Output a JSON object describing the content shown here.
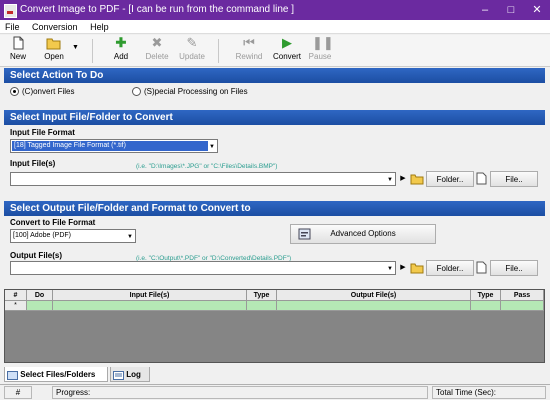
{
  "window": {
    "title": "Convert Image to PDF - [I can be run from the command line ]",
    "minimize": "–",
    "maximize": "□",
    "close": "✕"
  },
  "menu": [
    "File",
    "Conversion",
    "Help"
  ],
  "toolbar": {
    "new": "New",
    "open": "Open",
    "add": "Add",
    "delete": "Delete",
    "update": "Update",
    "rewind": "Rewind",
    "convert": "Convert",
    "pause": "Pause"
  },
  "select_action": {
    "header": "Select Action To Do",
    "option_convert": "(C)onvert Files",
    "option_special": "(S)pecial Processing on Files",
    "selected": "convert"
  },
  "input": {
    "header": "Select Input File/Folder to Convert",
    "format_label": "Input File Format",
    "format_value": "[18] Tagged Image File Format (*.tif)",
    "files_label": "Input File(s)",
    "files_hint": "(i.e. \"D:\\Images\\*.JPG\" or \"C:\\Files\\Details.BMP\")",
    "files_value": "",
    "folder_button": "Folder..",
    "file_button": "File.."
  },
  "output": {
    "header": "Select Output File/Folder and Format to Convert to",
    "format_label": "Convert to File Format",
    "format_value": "[100] Adobe (PDF)",
    "advanced_button": "Advanced Options",
    "files_label": "Output File(s)",
    "files_hint": "(i.e. \"C:\\Output\\*.PDF\" or \"D:\\Converted\\Details.PDF\")",
    "files_value": "",
    "folder_button": "Folder..",
    "file_button": "File.."
  },
  "grid": {
    "columns": [
      "#",
      "Do",
      "Input File(s)",
      "Type",
      "Output File(s)",
      "Type",
      "Pass"
    ],
    "new_row_marker": "*"
  },
  "tabs": {
    "files": "Select Files/Folders",
    "log": "Log"
  },
  "status": {
    "number": "#",
    "progress": "Progress:",
    "total_time": "Total Time (Sec):"
  },
  "colors": {
    "title_bar": "#6b2aa0",
    "section_band": "#1c4ea3",
    "hint_text": "#2a9d8f",
    "grid_new_row": "#b5e8b5",
    "dropdown_selected": "#3366cc"
  }
}
